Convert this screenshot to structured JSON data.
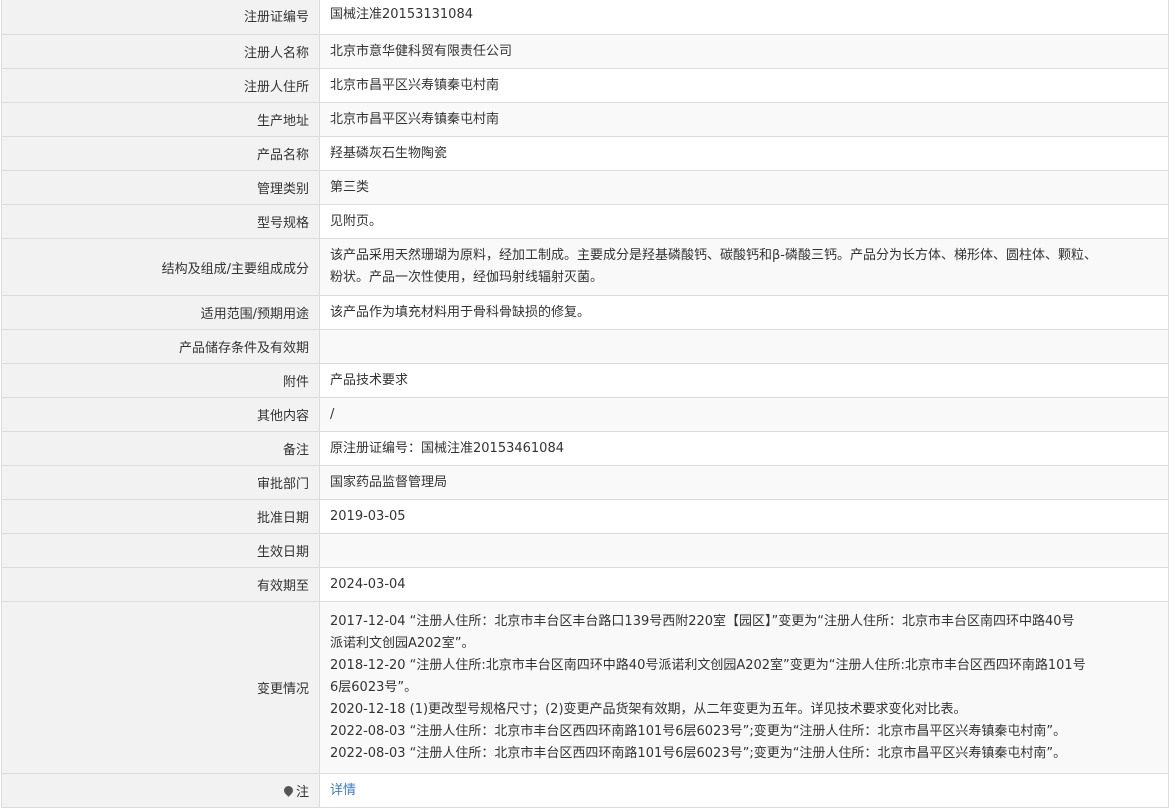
{
  "rows": [
    {
      "label": "注册证编号",
      "value": "国械注准20153131084"
    },
    {
      "label": "注册人名称",
      "value": "北京市意华健科贸有限责任公司"
    },
    {
      "label": "注册人住所",
      "value": "北京市昌平区兴寿镇秦屯村南"
    },
    {
      "label": "生产地址",
      "value": "北京市昌平区兴寿镇秦屯村南"
    },
    {
      "label": "产品名称",
      "value": "羟基磷灰石生物陶瓷"
    },
    {
      "label": "管理类别",
      "value": "第三类"
    },
    {
      "label": "型号规格",
      "value": "见附页。"
    },
    {
      "label": "结构及组成/主要组成成分",
      "value_lines": [
        "该产品采用天然珊瑚为原料，经加工制成。主要成分是羟基磷酸钙、碳酸钙和β-磷酸三钙。产品分为长方体、梯形体、圆柱体、颗粒、",
        "粉状。产品一次性使用，经伽玛射线辐射灭菌。"
      ]
    },
    {
      "label": "适用范围/预期用途",
      "value": "该产品作为填充材料用于骨科骨缺损的修复。"
    },
    {
      "label": "产品储存条件及有效期",
      "value": ""
    },
    {
      "label": "附件",
      "value": "产品技术要求"
    },
    {
      "label": "其他内容",
      "value": "/"
    },
    {
      "label": "备注",
      "value": "原注册证编号：国械注准20153461084"
    },
    {
      "label": "审批部门",
      "value": "国家药品监督管理局"
    },
    {
      "label": "批准日期",
      "value": "2019-03-05"
    },
    {
      "label": "生效日期",
      "value": ""
    },
    {
      "label": "有效期至",
      "value": "2024-03-04"
    },
    {
      "label": "变更情况",
      "value_lines": [
        "2017-12-04 “注册人住所：北京市丰台区丰台路口139号西附220室【园区】”变更为“注册人住所：北京市丰台区南四环中路40号",
        "派诺利文创园A202室”。",
        "2018-12-20 “注册人住所:北京市丰台区南四环中路40号派诺利文创园A202室”变更为“注册人住所:北京市丰台区西四环南路101号",
        "6层6023号”。",
        "2020-12-18 (1)更改型号规格尺寸；(2)变更产品货架有效期，从二年变更为五年。详见技术要求变化对比表。",
        "2022-08-03 “注册人住所：北京市丰台区西四环南路101号6层6023号”;变更为“注册人住所：北京市昌平区兴寿镇秦屯村南”。",
        "2022-08-03 “注册人住所：北京市丰台区西四环南路101号6层6023号”;变更为“注册人住所：北京市昌平区兴寿镇秦屯村南”。"
      ]
    },
    {
      "label": "注",
      "icon": "pin-icon",
      "value": "详情",
      "link": true
    }
  ]
}
